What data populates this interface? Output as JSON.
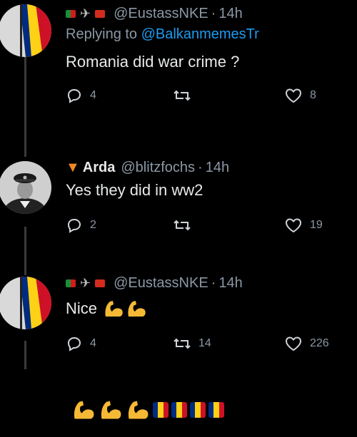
{
  "thread": [
    {
      "avatar_desc": "romanian-flag-avatar",
      "name": "",
      "handle": "@EustassNKE",
      "time": "14h",
      "replying_prefix": "Replying to",
      "replying_to": "@BalkanmemesTr",
      "text": "Romania did war crime ?",
      "replies": "4",
      "retweets": "",
      "likes": "8"
    },
    {
      "avatar_desc": "naval-officer-photo-avatar",
      "name": "Arda",
      "handle": "@blitzfochs",
      "time": "14h",
      "text": "Yes they did in ww2",
      "replies": "2",
      "retweets": "",
      "likes": "19"
    },
    {
      "avatar_desc": "romanian-flag-avatar",
      "name": "",
      "handle": "@EustassNKE",
      "time": "14h",
      "text": "Nice",
      "replies": "4",
      "retweets": "14",
      "likes": "226"
    }
  ],
  "separator": "·",
  "bottom_emojis": [
    "flexed-biceps",
    "flexed-biceps",
    "flexed-biceps",
    "romania-flag",
    "romania-flag",
    "romania-flag",
    "romania-flag"
  ],
  "colors": {
    "background": "#000000",
    "text": "#e7e9ea",
    "muted": "#8b98a5",
    "link": "#1d9bf0",
    "ro_blue": "#002B7F",
    "ro_yellow": "#FCD116",
    "ro_red": "#CE1126"
  }
}
